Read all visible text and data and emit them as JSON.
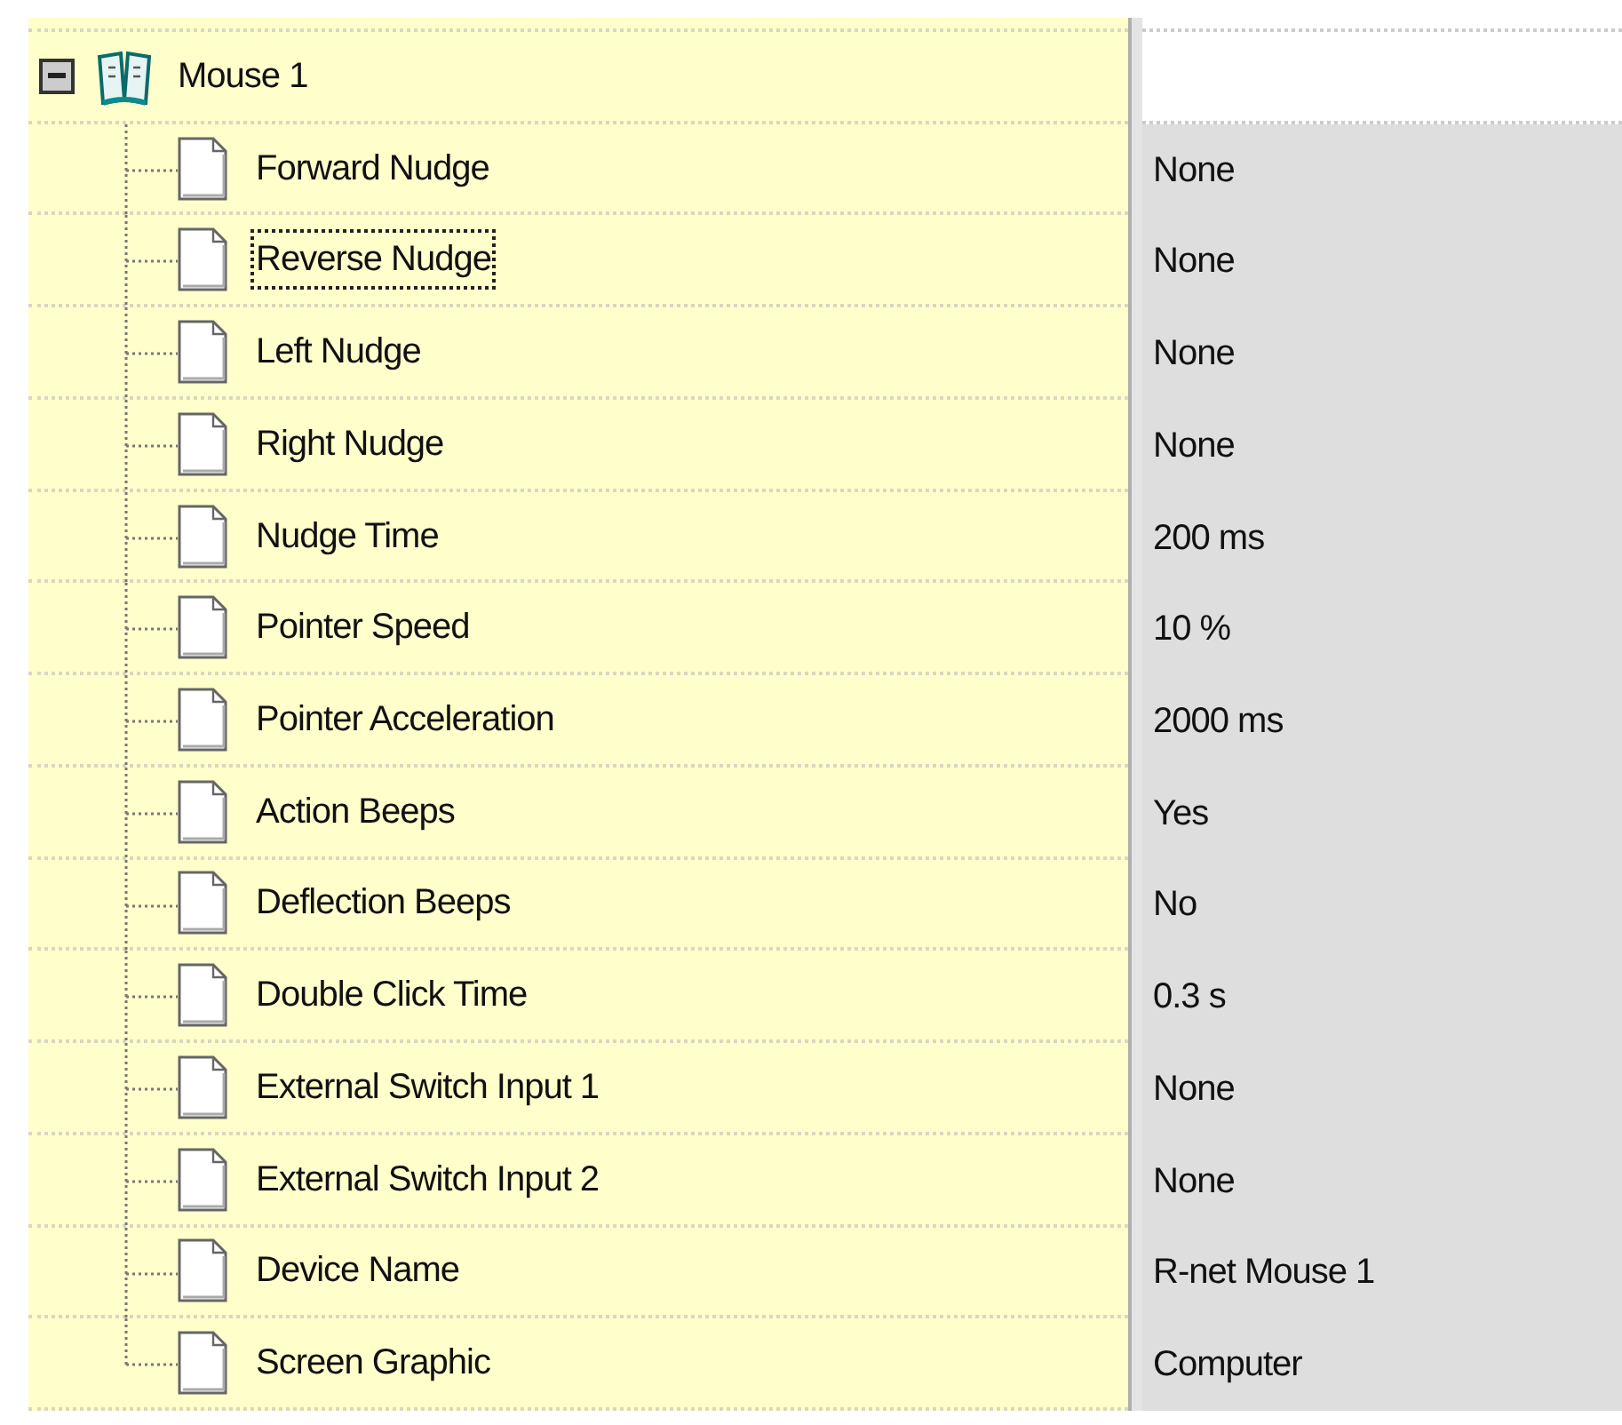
{
  "tree": {
    "label": "Mouse 1",
    "expanded": true,
    "children": [
      {
        "label": "Forward Nudge",
        "value": "None",
        "selected": false
      },
      {
        "label": "Reverse Nudge",
        "value": "None",
        "selected": true
      },
      {
        "label": "Left Nudge",
        "value": "None",
        "selected": false
      },
      {
        "label": "Right Nudge",
        "value": "None",
        "selected": false
      },
      {
        "label": "Nudge Time",
        "value": "200 ms",
        "selected": false
      },
      {
        "label": "Pointer Speed",
        "value": "10 %",
        "selected": false
      },
      {
        "label": "Pointer Acceleration",
        "value": "2000 ms",
        "selected": false
      },
      {
        "label": "Action Beeps",
        "value": "Yes",
        "selected": false
      },
      {
        "label": "Deflection Beeps",
        "value": "No",
        "selected": false
      },
      {
        "label": "Double Click Time",
        "value": "0.3 s",
        "selected": false
      },
      {
        "label": "External Switch Input 1",
        "value": "None",
        "selected": false
      },
      {
        "label": "External Switch Input 2",
        "value": "None",
        "selected": false
      },
      {
        "label": "Device Name",
        "value": "R-net Mouse 1",
        "selected": false
      },
      {
        "label": "Screen Graphic",
        "value": "Computer",
        "selected": false
      }
    ]
  }
}
